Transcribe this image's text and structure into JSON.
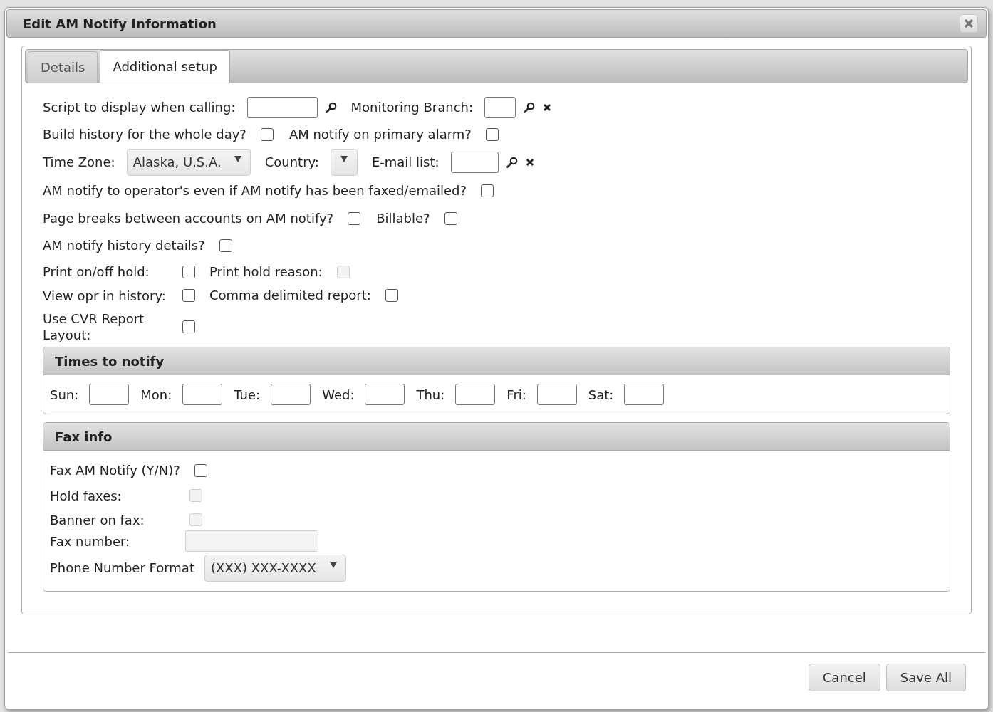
{
  "window": {
    "title": "Edit AM Notify Information"
  },
  "tabs": [
    {
      "label": "Details",
      "selected": false
    },
    {
      "label": "Additional setup",
      "selected": true
    }
  ],
  "general_settings": [
    {
      "fields": [
        {
          "kind": "lookup",
          "label": "Script to display when calling:",
          "disabled": false,
          "clear_button": false
        },
        {
          "kind": "lookup",
          "label": "Monitoring Branch:",
          "disabled": false,
          "clear_button": true
        }
      ]
    },
    {
      "fields": [
        {
          "kind": "checkbox",
          "label": "Build history for the whole day?",
          "checked": false,
          "disabled": false
        },
        {
          "kind": "checkbox",
          "label": "AM notify on primary alarm?",
          "checked": false,
          "disabled": false
        }
      ]
    },
    {
      "fields": [
        {
          "kind": "select",
          "label": "Time Zone:",
          "value": "Alaska, U.S.A.",
          "disabled": false
        },
        {
          "kind": "select",
          "label": "Country:",
          "disabled": false
        },
        {
          "kind": "lookup",
          "label": "E-mail list:",
          "disabled": false,
          "clear_button": true
        }
      ]
    },
    {
      "fields": [
        {
          "kind": "checkbox",
          "label": "AM notify to operator's even if AM notify has been faxed/emailed?",
          "checked": false,
          "disabled": false
        }
      ]
    },
    {
      "fields": [
        {
          "kind": "checkbox",
          "label": "Page breaks between accounts on AM notify?",
          "checked": false,
          "disabled": false
        },
        {
          "kind": "checkbox",
          "label": "Billable?",
          "checked": false,
          "disabled": false
        }
      ]
    },
    {
      "fields": [
        {
          "kind": "checkbox",
          "label": "AM notify history details?",
          "checked": false,
          "disabled": false
        }
      ]
    },
    {
      "fields": [
        {
          "kind": "checkbox",
          "label": "Print on/off hold:",
          "checked": false,
          "disabled": false
        },
        {
          "kind": "checkbox",
          "label": "Print hold reason:",
          "checked": false,
          "disabled": true
        }
      ]
    },
    {
      "fields": [
        {
          "kind": "checkbox",
          "label": "View opr in history:",
          "checked": false,
          "disabled": false
        },
        {
          "kind": "checkbox",
          "label": "Comma delimited report:",
          "checked": false,
          "disabled": false
        }
      ]
    },
    {
      "fields": [
        {
          "kind": "checkbox",
          "label": "Use CVR Report Layout:",
          "checked": false,
          "disabled": false
        }
      ]
    }
  ],
  "times_to_notify": {
    "title": "Times to notify",
    "days": [
      {
        "label": "Sun:"
      },
      {
        "label": "Mon:"
      },
      {
        "label": "Tue:"
      },
      {
        "label": "Wed:"
      },
      {
        "label": "Thu:"
      },
      {
        "label": "Fri:"
      },
      {
        "label": "Sat:"
      }
    ]
  },
  "fax_info": {
    "title": "Fax info",
    "fields": [
      {
        "kind": "checkbox",
        "label": "Fax AM Notify (Y/N)?",
        "checked": false,
        "disabled": false
      },
      {
        "kind": "checkbox",
        "label": "Hold faxes:",
        "checked": false,
        "disabled": true
      },
      {
        "kind": "checkbox",
        "label": "Banner on fax:",
        "checked": false,
        "disabled": true
      },
      {
        "kind": "text",
        "label": "Fax number:",
        "disabled": true
      },
      {
        "kind": "select",
        "label": "Phone Number Format",
        "value": "(XXX) XXX-XXXX",
        "disabled": false
      }
    ]
  },
  "buttons": [
    {
      "label": "Cancel"
    },
    {
      "label": "Save All"
    }
  ]
}
